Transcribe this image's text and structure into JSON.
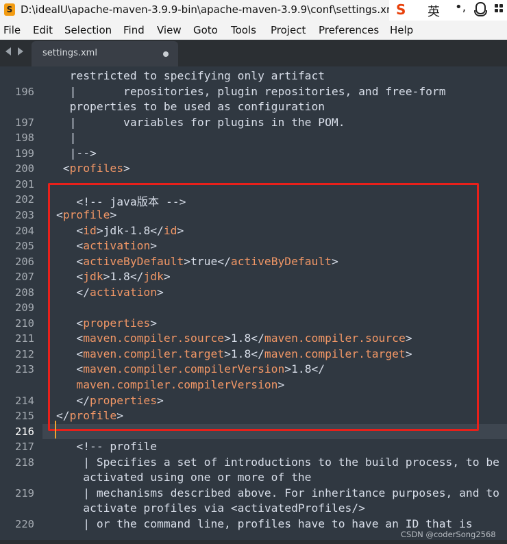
{
  "window": {
    "title": "D:\\idealU\\apache-maven-3.9.9-bin\\apache-maven-3.9.9\\conf\\settings.xml",
    "app_icon": "S",
    "ime": {
      "logo": "S",
      "language": "英",
      "punct": "•,",
      "icons": [
        "mic-icon",
        "grid-icon"
      ]
    }
  },
  "menu": [
    "File",
    "Edit",
    "Selection",
    "Find",
    "View",
    "Goto",
    "Tools",
    "Project",
    "Preferences",
    "Help"
  ],
  "tabs": [
    {
      "label": "settings.xml",
      "modified": true
    }
  ],
  "editor": {
    "current_line": "216",
    "rows": [
      {
        "ln": "",
        "parts": [
          {
            "t": "  restricted to specifying only artifact",
            "c": "c"
          }
        ]
      },
      {
        "ln": "196",
        "parts": [
          {
            "t": "  |       repositories, plugin repositories, and free-form",
            "c": "c"
          }
        ]
      },
      {
        "ln": "",
        "parts": [
          {
            "t": "  properties to be used as configuration",
            "c": "c"
          }
        ]
      },
      {
        "ln": "197",
        "parts": [
          {
            "t": "  |       variables for plugins in the POM.",
            "c": "c"
          }
        ]
      },
      {
        "ln": "198",
        "parts": [
          {
            "t": "  |",
            "c": "c"
          }
        ]
      },
      {
        "ln": "199",
        "parts": [
          {
            "t": "  |-->",
            "c": "c"
          }
        ]
      },
      {
        "ln": "200",
        "parts": [
          {
            "t": " <",
            "c": "c"
          },
          {
            "t": "profiles",
            "c": "tg"
          },
          {
            "t": ">",
            "c": "c"
          }
        ]
      },
      {
        "ln": "201",
        "parts": []
      },
      {
        "ln": "202",
        "parts": [
          {
            "t": "   <!-- java版本 -->",
            "c": "cm"
          }
        ]
      },
      {
        "ln": "203",
        "parts": [
          {
            "t": "<",
            "c": "c"
          },
          {
            "t": "profile",
            "c": "tg"
          },
          {
            "t": ">",
            "c": "c"
          }
        ]
      },
      {
        "ln": "204",
        "parts": [
          {
            "t": "   <",
            "c": "c"
          },
          {
            "t": "id",
            "c": "tg"
          },
          {
            "t": ">jdk-1.8</",
            "c": "c"
          },
          {
            "t": "id",
            "c": "tg"
          },
          {
            "t": ">",
            "c": "c"
          }
        ]
      },
      {
        "ln": "205",
        "parts": [
          {
            "t": "   <",
            "c": "c"
          },
          {
            "t": "activation",
            "c": "tg"
          },
          {
            "t": ">",
            "c": "c"
          }
        ]
      },
      {
        "ln": "206",
        "parts": [
          {
            "t": "   <",
            "c": "c"
          },
          {
            "t": "activeByDefault",
            "c": "tg"
          },
          {
            "t": ">true</",
            "c": "c"
          },
          {
            "t": "activeByDefault",
            "c": "tg"
          },
          {
            "t": ">",
            "c": "c"
          }
        ]
      },
      {
        "ln": "207",
        "parts": [
          {
            "t": "   <",
            "c": "c"
          },
          {
            "t": "jdk",
            "c": "tg"
          },
          {
            "t": ">1.8</",
            "c": "c"
          },
          {
            "t": "jdk",
            "c": "tg"
          },
          {
            "t": ">",
            "c": "c"
          }
        ]
      },
      {
        "ln": "208",
        "parts": [
          {
            "t": "   </",
            "c": "c"
          },
          {
            "t": "activation",
            "c": "tg"
          },
          {
            "t": ">",
            "c": "c"
          }
        ]
      },
      {
        "ln": "209",
        "parts": []
      },
      {
        "ln": "210",
        "parts": [
          {
            "t": "   <",
            "c": "c"
          },
          {
            "t": "properties",
            "c": "tg"
          },
          {
            "t": ">",
            "c": "c"
          }
        ]
      },
      {
        "ln": "211",
        "parts": [
          {
            "t": "   <",
            "c": "c"
          },
          {
            "t": "maven.compiler.source",
            "c": "tg"
          },
          {
            "t": ">1.8</",
            "c": "c"
          },
          {
            "t": "maven.compiler.source",
            "c": "tg"
          },
          {
            "t": ">",
            "c": "c"
          }
        ]
      },
      {
        "ln": "212",
        "parts": [
          {
            "t": "   <",
            "c": "c"
          },
          {
            "t": "maven.compiler.target",
            "c": "tg"
          },
          {
            "t": ">1.8</",
            "c": "c"
          },
          {
            "t": "maven.compiler.target",
            "c": "tg"
          },
          {
            "t": ">",
            "c": "c"
          }
        ]
      },
      {
        "ln": "213",
        "parts": [
          {
            "t": "   <",
            "c": "c"
          },
          {
            "t": "maven.compiler.compilerVersion",
            "c": "tg"
          },
          {
            "t": ">1.8</",
            "c": "c"
          }
        ]
      },
      {
        "ln": "",
        "parts": [
          {
            "t": "   ",
            "c": "c"
          },
          {
            "t": "maven.compiler.compilerVersion",
            "c": "tg"
          },
          {
            "t": ">",
            "c": "c"
          }
        ]
      },
      {
        "ln": "214",
        "parts": [
          {
            "t": "   </",
            "c": "c"
          },
          {
            "t": "properties",
            "c": "tg"
          },
          {
            "t": ">",
            "c": "c"
          }
        ]
      },
      {
        "ln": "215",
        "parts": [
          {
            "t": "</",
            "c": "c"
          },
          {
            "t": "profile",
            "c": "tg"
          },
          {
            "t": ">",
            "c": "c"
          }
        ]
      },
      {
        "ln": "216",
        "parts": []
      },
      {
        "ln": "217",
        "parts": [
          {
            "t": "   <!-- profile",
            "c": "cm"
          }
        ]
      },
      {
        "ln": "218",
        "parts": [
          {
            "t": "    | Specifies a set of introductions to the build process, to be",
            "c": "c"
          }
        ]
      },
      {
        "ln": "",
        "parts": [
          {
            "t": "    activated using one or more of the",
            "c": "c"
          }
        ]
      },
      {
        "ln": "219",
        "parts": [
          {
            "t": "    | mechanisms described above. For inheritance purposes, and to",
            "c": "c"
          }
        ]
      },
      {
        "ln": "",
        "parts": [
          {
            "t": "    activate profiles via <activatedProfiles/>",
            "c": "c"
          }
        ]
      },
      {
        "ln": "220",
        "parts": [
          {
            "t": "    | or the command line, profiles have to have an ID that is",
            "c": "c"
          }
        ]
      }
    ]
  },
  "watermark": "CSDN @coderSong2568"
}
